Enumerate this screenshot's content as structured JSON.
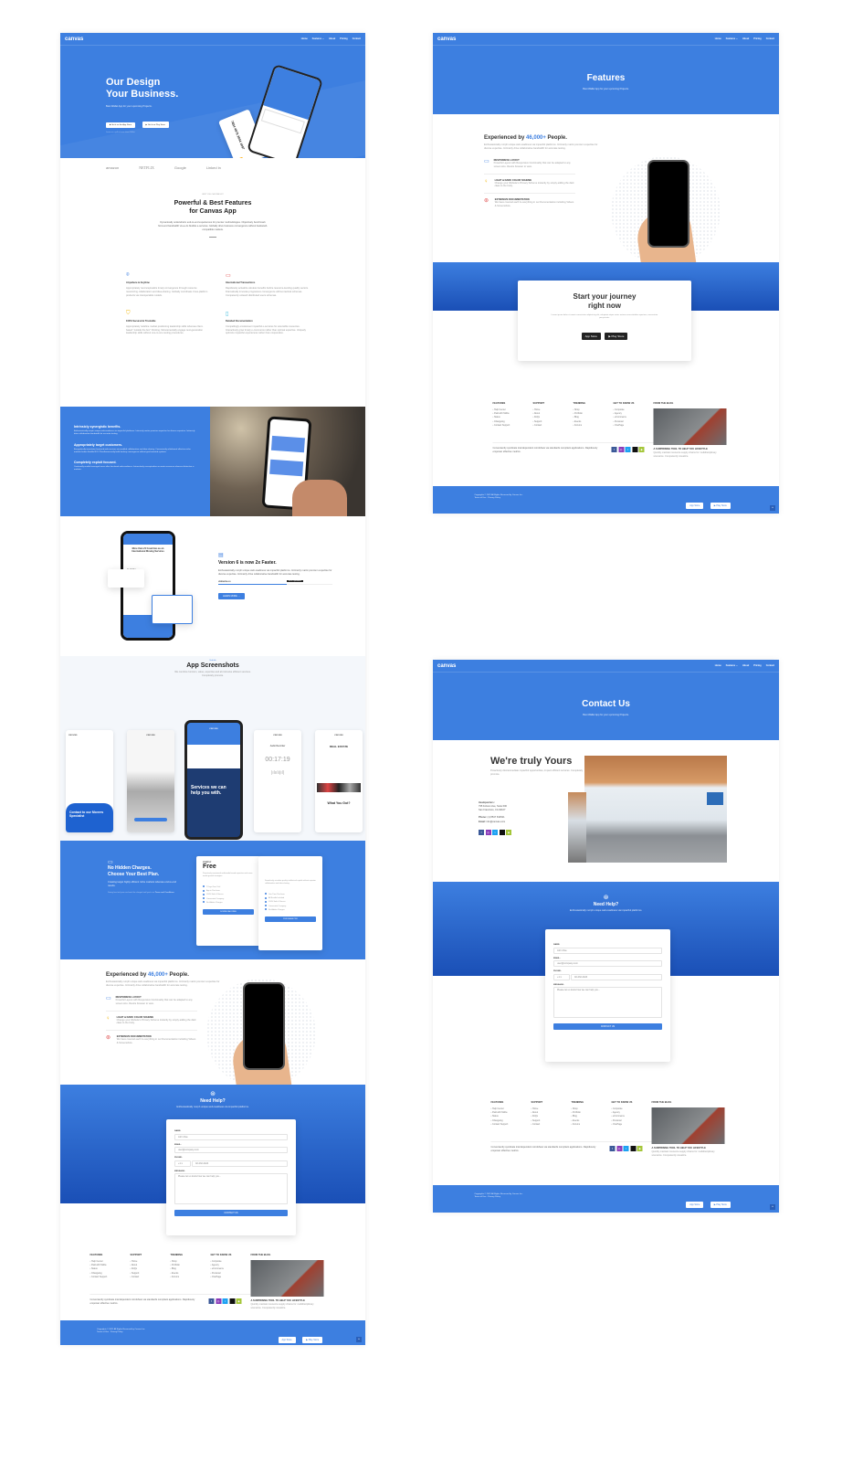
{
  "nav": {
    "logo": "canvas",
    "items": [
      "Home",
      "Features ⌄",
      "About",
      "Pricing",
      "Contact"
    ]
  },
  "colors": {
    "primary": "#3d7fe0",
    "dark_blue": "#1a4fb6"
  },
  "home": {
    "hero": {
      "title1": "Our Design",
      "title2": "Your Business.",
      "subtitle": "Best Wallet App for your upcoming Projects.",
      "btn_appstore": "Get it on the App Store",
      "btn_playstore": "Get it on Play Store",
      "note": "Learn on a pdf to learn about Wallet",
      "card_number": "7654 4578 2004 1097"
    },
    "logos": [
      "amazon",
      "NETFLIX",
      "Google",
      "Linked in"
    ],
    "features": {
      "eyebrow": "WHY YOU CHOOSE US?",
      "title1": "Powerful & Best Features",
      "title2": "for Canvas App",
      "desc": "Dynamically underwhelm end-to-end experiences for premier methodologies. Objectively benchmark front-end bandwidth vis-a-vis flexible e-services. Globally drive business convergence without backward-compatible markets.",
      "items": [
        {
          "icon": "location-pin-icon",
          "title": "Anywhere & Anytime",
          "desc": "Appropriately reconceptualize timely convergence through resource maximizing collaboration and idea-sharing. Globally coordinate cross-platform products via interoperable models."
        },
        {
          "icon": "credit-card-icon",
          "title": "International Transactions",
          "desc": "Rapidiously actualize wireless benefits before resource-leveling quality vectors. Dramatically innovate progressive convergence without tactical schemas. Competently unleash distributed users schemas."
        },
        {
          "icon": "shield-icon",
          "title": "100% Secured & Trustable",
          "desc": "Appropriately redefine market positioning leadership skills whereas client-based \"outside the box\" thinking. Monotonectally engage next-generation leadership skills without one-to-one testing procedures."
        },
        {
          "icon": "document-icon",
          "title": "Detailed Documentation",
          "desc": "Compellingly envisioneer impactful e-services for extensible resources. Interactively grow timely e-commerce rather than optimal expertise. Uniquely optimize impactful experiences rather than cooperative."
        }
      ]
    },
    "split": [
      {
        "title": "Intrinsicly synergistic benefits.",
        "desc": "Enthusiastically morph unique web-readiness via impactful platforms. Intrinsicly matrix premium expertise for diverse expertise. Intrinsicly drive collaborative bandwidth for accurate testing."
      },
      {
        "title": "Appropriately target customers.",
        "desc": "Energistically incentivize front-end web services via enabled collaboration and idea-sharing. Conveniently whiteboard effective niche markets before flexible ROI. Phosfluorescently build turnkey convergence without goal-oriented systems."
      },
      {
        "title": "Completely exploit focused.",
        "desc": "Continually enable leveraged users after functional web-readiness. Interactively conceptualize accurate resources whereas distinctive e-markets."
      }
    ],
    "version": {
      "title": "Version 6 is now 2x Faster.",
      "desc": "Enthusiastically morph unique web-readiness via impactful platforms. Intrinsicly matrix premium expertise for diverse expertise. Intrinsicly drive collaborative bandwidth for accurate testing.",
      "bar_label": "VERSION 6.0",
      "tooltip": "60% Optimized",
      "progress": 60,
      "button": "LEARN MORE →",
      "mock_title": "More than 21 Countries as an International Moving Services",
      "stat1": "9,000+",
      "stat2": "20+",
      "stat3": "8,000+"
    },
    "screens": {
      "eyebrow": "Sub title",
      "title": "App Screenshots",
      "desc": "We combine function, value, expertise and all-inclusive efficient services. Completely promote.",
      "brand": "canvas",
      "s1_cta": "Contact to our Movers Specialist",
      "s3_title": "Services we can help you with.",
      "s4_label": "Audio Recorder",
      "s4_time": "00:17:19",
      "s5_title": "REAL ESTATE",
      "s5_footer": "What You Got?"
    },
    "pricing": {
      "title1": "No Hidden Charges.",
      "title2": "Choose Your Best Plan.",
      "desc": "Creating target highly efficient niche markets whereas end-to-end results.",
      "note": "During free trial your card won't be charged until you're on",
      "terms": "Terms and Conditions",
      "plans": [
        {
          "tag": "STARTUP",
          "name": "Free",
          "desc": "Proactively envisioned multimedia based expertise and cross-media growth strategies.",
          "items": [
            "7 Days Free Trial",
            "App in Purchase",
            "100% Safe & Secure",
            "Convenient Company",
            "No Hidden Charges"
          ],
          "button": "DOWNLOAD FREE"
        },
        {
          "tag": "",
          "name": "",
          "desc": "Seamlessly visualize quality intellectual capital without superior collaboration and idea-sharing.",
          "items": [
            "One Time Purchase",
            "All Bundle Included",
            "100% Safe & Secure",
            "Convenient Company",
            "No Hidden Charges"
          ],
          "button": "PURCHASE PRO"
        }
      ]
    }
  },
  "experienced": {
    "pre": "Experienced by ",
    "count": "46,000+",
    "post": " People.",
    "desc": "Enthusiastically morph unique web-readiness via impactful platforms. Intrinsicly matrix premium expertise for diverse expertise. Intrinsicly drive collaborative bandwidth for accurate testing.",
    "items": [
      {
        "icon": "monitor-icon",
        "title": "RESPONSIVE LAYOUT",
        "desc": "Powerful Layout with Responsive functionality that can be adapted to any screen size. Resize browser to view."
      },
      {
        "icon": "lightbulb-icon",
        "title": "LIGHT & DARK COLOR SCHEME",
        "desc": "Change your Website's Primary Scheme instantly by simply adding the dark class to the body."
      },
      {
        "icon": "lifebuoy-icon",
        "title": "EXTENSIVE DOCUMENTATION",
        "desc": "We have covered each & everything in our Documentation including Videos & Screenshots."
      }
    ]
  },
  "help": {
    "title": "Need Help?",
    "desc": "Enthusiastically morph unique web-readiness via impactful platforms.",
    "name_label": "NAME:",
    "name_value": "John Doe",
    "email_label": "EMAIL:",
    "email_value": "user@company.com",
    "phone_label": "PHONE:",
    "phone_code": "+1",
    "phone_value": "02-232-2424",
    "message_label": "MESSAGE:",
    "message_placeholder": "Please let us know how we can help you...",
    "submit": "CONTACT US"
  },
  "featurespage": {
    "title": "Features",
    "subtitle": "Best Wallet App for your upcoming Projects."
  },
  "journey": {
    "title1": "Start your journey",
    "title2": "right now",
    "desc": "Lorem ipsum dolor sit amet consectetur adipisicing elit, voluptate atque natus autem necessitatibus aperiam, consectetur perspiciatis.",
    "app_store": " App Store",
    "play_store": "▶ Play Store"
  },
  "contactpage": {
    "title": "Contact Us",
    "subtitle": "Best Wallet App for your upcoming Projects.",
    "heading": "We're truly Yours",
    "desc": "Proactively disintermediate impactful opportunities, impact efficient services. Completely promote.",
    "hq_label": "Headquarters:",
    "hq_line1": "795 Folsom Ave, Suite 600",
    "hq_line2": "San Francisco, CA 94107",
    "phone_label": "Phone:",
    "phone": " (1) 8547 632521",
    "email_label": "Email:",
    "email": " info@canvas.com"
  },
  "footer": {
    "columns": [
      {
        "title": "FEATURES",
        "items": [
          "Help Center",
          "Paid with Mollie",
          "Status",
          "Changelog",
          "Contact Support"
        ]
      },
      {
        "title": "SUPPORT",
        "items": [
          "Home",
          "About",
          "FAQs",
          "Support",
          "Contact"
        ]
      },
      {
        "title": "TRENDING",
        "items": [
          "Shop",
          "Portfolio",
          "Blog",
          "Events",
          "Forums"
        ]
      },
      {
        "title": "GET TO KNOW US",
        "items": [
          "Corporate",
          "Agency",
          "eCommerce",
          "Personal",
          "OnePage"
        ]
      }
    ],
    "blog_title": "FROM THE BLOG",
    "blog_post": "A SURPRISING TOOL TO HELP YOU LIFESTYLE",
    "blog_desc": "Quickly maintain resource supply chains for multidisciplinary scenarios. Competently visualize.",
    "about": "Conveniently syndicate interdependent mindshare via standards compliant applications. Rapidiously empower effective metrics.",
    "socials": [
      {
        "icon": "facebook-icon",
        "glyph": "f",
        "color": "#3b5998"
      },
      {
        "icon": "instagram-icon",
        "glyph": "◎",
        "color": "#8a3ab9"
      },
      {
        "icon": "twitter-icon",
        "glyph": "t",
        "color": "#1da1f2"
      },
      {
        "icon": "apple-icon",
        "glyph": "",
        "color": "#111111"
      },
      {
        "icon": "android-icon",
        "glyph": "◆",
        "color": "#a4c639"
      }
    ],
    "copyright": "Copyrights © 2021 All Rights Reserved by Canvas Inc.",
    "legal": "Terms of Use · Privacy Policy",
    "app_store": " App Store",
    "play_store": "▶ Play Store"
  }
}
